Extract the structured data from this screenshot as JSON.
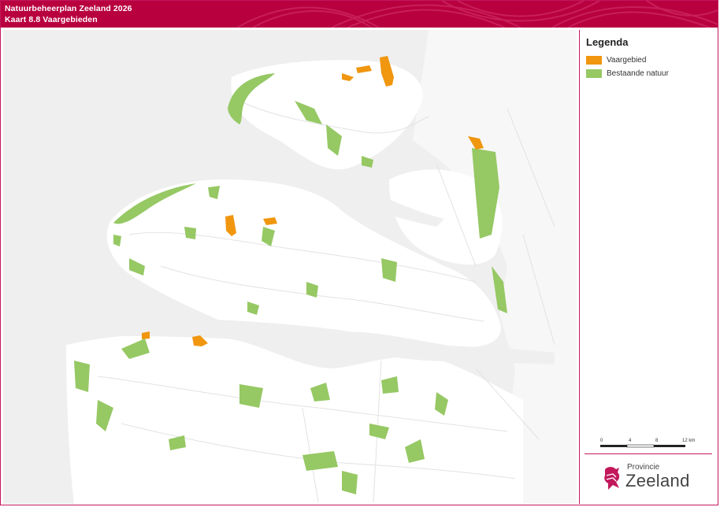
{
  "header": {
    "title_line1": "Natuurbeheerplan Zeeland 2026",
    "title_line2": "Kaart 8.8 Vaargebieden",
    "color": "#b8003f"
  },
  "legend": {
    "title": "Legenda",
    "items": [
      {
        "label": "Vaargebied",
        "color": "#f0960f"
      },
      {
        "label": "Bestaande natuur",
        "color": "#96c864"
      }
    ]
  },
  "scalebar": {
    "ticks": [
      "0",
      "4",
      "8",
      "12 km"
    ]
  },
  "logo": {
    "small_text": "Provincie",
    "big_text": "Zeeland",
    "icon": "zeeland-lion-icon"
  },
  "colors": {
    "land": "#ffffff",
    "water": "#efefef",
    "nature": "#96c864",
    "vaargebied": "#f0960f",
    "frame": "#c2185b"
  }
}
